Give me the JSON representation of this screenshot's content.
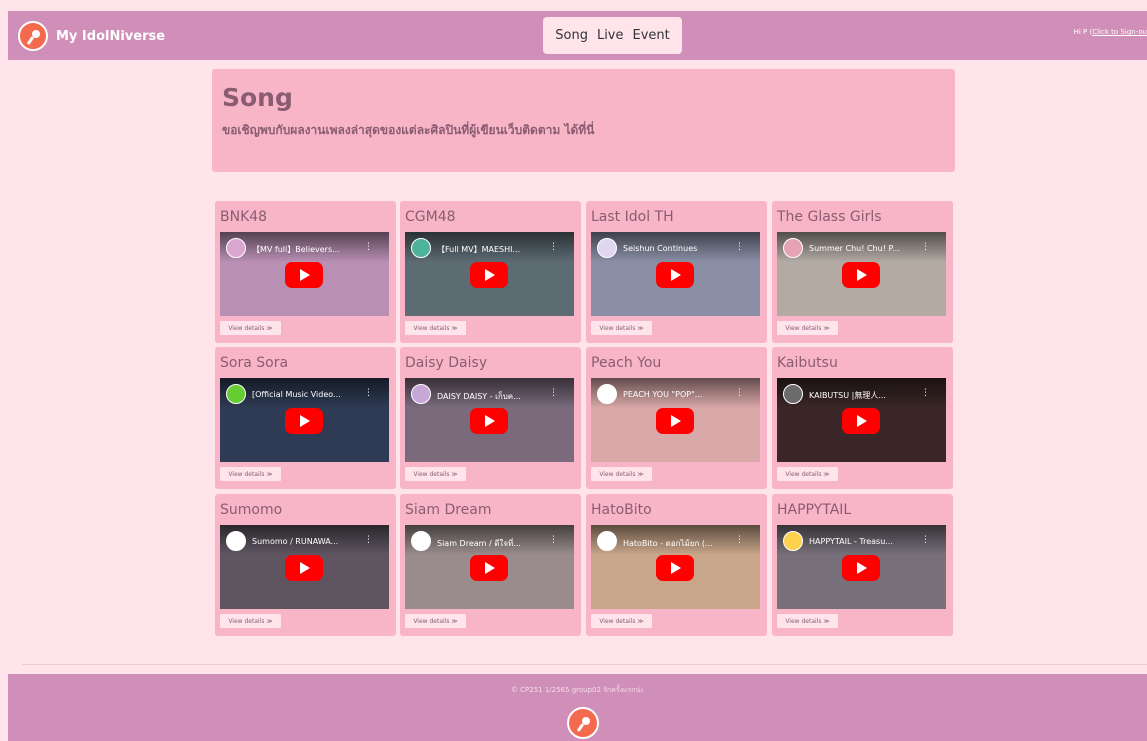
{
  "header": {
    "brand": "My IdolNiverse",
    "nav": [
      "Song",
      "Live",
      "Event"
    ],
    "greeting_prefix": "Hi P (",
    "greeting_link": "Click to Sign-ou"
  },
  "hero": {
    "title": "Song",
    "description": "ขอเชิญพบกับผลงานเพลงล่าสุดของแต่ละศิลปินที่ผู้เขียนเว็บติดตาม ได้ที่นี่"
  },
  "cards": [
    {
      "artist": "BNK48",
      "video_title": "【MV full】Believers...",
      "thumb_color": "#b98fb4",
      "chan_color": "#d9a7cf",
      "details": "View details ≫"
    },
    {
      "artist": "CGM48",
      "video_title": "【Full MV】MAESHI...",
      "thumb_color": "#5d6b73",
      "chan_color": "#4db39a",
      "details": "View details ≫"
    },
    {
      "artist": "Last Idol TH",
      "video_title": "Seishun Continues",
      "thumb_color": "#8a8fa6",
      "chan_color": "#e0d6ef",
      "details": "View details ≫"
    },
    {
      "artist": "The Glass Girls",
      "video_title": "Summer Chu! Chu! P...",
      "thumb_color": "#b2aaa3",
      "chan_color": "#e7a3b6",
      "details": "View details ≫"
    },
    {
      "artist": "Sora Sora",
      "video_title": "[Official Music Video...",
      "thumb_color": "#2f3b54",
      "chan_color": "#66cc33",
      "details": "View details ≫"
    },
    {
      "artist": "Daisy Daisy",
      "video_title": "DAISY DAISY - เก็บค...",
      "thumb_color": "#7a6a7c",
      "chan_color": "#c7a7d8",
      "details": "View details ≫"
    },
    {
      "artist": "Peach You",
      "video_title": "PEACH YOU \"POP\"...",
      "thumb_color": "#d9a8a8",
      "chan_color": "#ffffff",
      "details": "View details ≫"
    },
    {
      "artist": "Kaibutsu",
      "video_title": "KAIBUTSU |無理人...",
      "thumb_color": "#3a2626",
      "chan_color": "#6b6b6b",
      "details": "View details ≫"
    },
    {
      "artist": "Sumomo",
      "video_title": "Sumomo / RUNAWA...",
      "thumb_color": "#5e5560",
      "chan_color": "#ffffff",
      "details": "View details ≫"
    },
    {
      "artist": "Siam Dream",
      "video_title": "Siam Dream / ดีใจที่...",
      "thumb_color": "#9a8c8c",
      "chan_color": "#ffffff",
      "details": "View details ≫"
    },
    {
      "artist": "HatoBito",
      "video_title": "HatoBito - ดอกไม้ยก (...",
      "thumb_color": "#c9a68a",
      "chan_color": "#ffffff",
      "details": "View details ≫"
    },
    {
      "artist": "HAPPYTAIL",
      "video_title": "HAPPYTAIL - Treasu...",
      "thumb_color": "#77707a",
      "chan_color": "#ffd24d",
      "details": "View details ≫"
    }
  ],
  "footer": {
    "copyright": "© CP251 1/2565 group02 รักครั้งแรกน่ะ"
  },
  "colors": {
    "header_bg": "#d08fb9",
    "page_bg": "#ffe4ec",
    "card_bg": "#f9b5c8",
    "play_red": "#ff0000"
  },
  "icons": {
    "brand_logo": "microphone-logo-icon",
    "play": "youtube-play-icon",
    "more": "kebab-menu-icon"
  }
}
